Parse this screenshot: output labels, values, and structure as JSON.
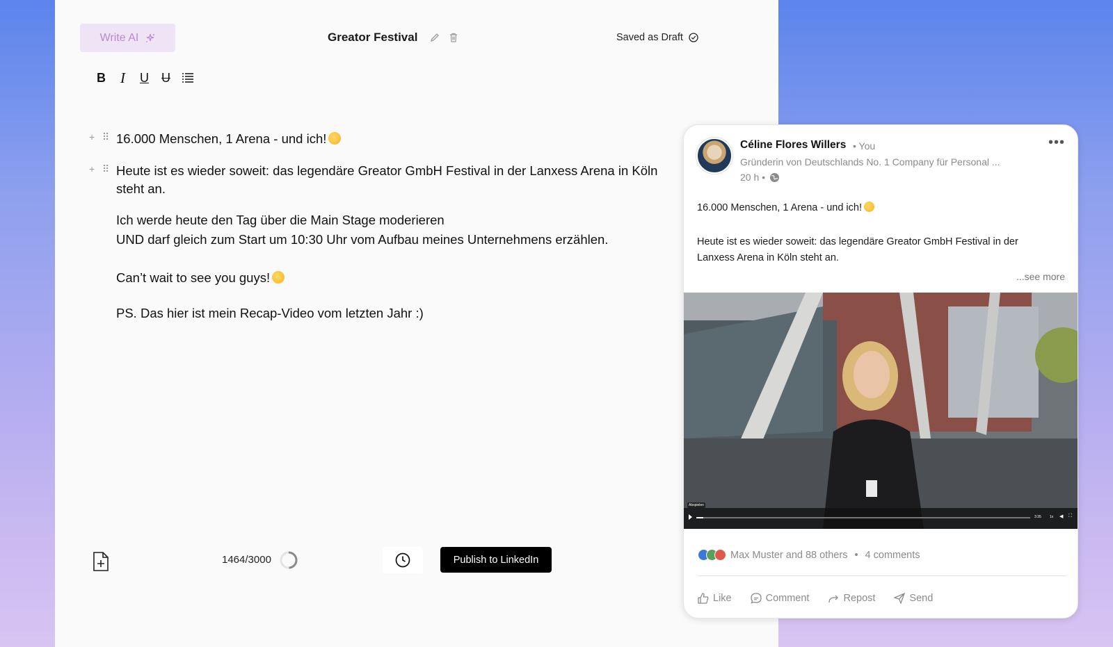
{
  "editor": {
    "write_ai_label": "Write AI",
    "doc_title": "Greator Festival",
    "status": "Saved as Draft",
    "toolbar": {
      "bold": "B",
      "italic": "I",
      "underline": "U",
      "strike": "U"
    },
    "blocks": {
      "b1": "16.000 Menschen, 1 Arena - und ich!",
      "b2_line1": "Heute ist es wieder soweit: das legendäre Greator GmbH Festival in der Lanxess Arena in Köln",
      "b2_line2": "steht an.",
      "b3_line1": "Ich werde heute den Tag über die Main Stage moderieren",
      "b3_line2": "UND darf gleich zum Start um 10:30 Uhr vom Aufbau meines Unternehmens erzählen.",
      "b4": "Can’t wait to see you guys!",
      "b5": "PS. Das hier ist mein Recap-Video vom letzten Jahr :)"
    },
    "char_count": "1464/3000",
    "char_count_fraction": 0.488,
    "publish_label": "Publish to LinkedIn"
  },
  "preview": {
    "author": "Céline Flores Willers",
    "you": "• You",
    "headline": "Gründerin von Deutschlands No. 1 Company für Personal ...",
    "time": "20 h •",
    "text1": "16.000 Menschen, 1 Arena - und ich!",
    "text2_line1": "Heute ist es wieder soweit: das legendäre Greator GmbH Festival in der",
    "text2_line2": "Lanxess Arena in Köln steht an.",
    "see_more": "...see more",
    "video_caption": "Abspielen",
    "video_time": "3:35",
    "video_speed": "1x",
    "reactions_text": "Max Muster and 88 others",
    "comments": "4 comments",
    "actions": {
      "like": "Like",
      "comment": "Comment",
      "repost": "Repost",
      "send": "Send"
    }
  },
  "colors": {
    "accent_purple": "#b58bd0",
    "publish_bg": "#000000"
  }
}
